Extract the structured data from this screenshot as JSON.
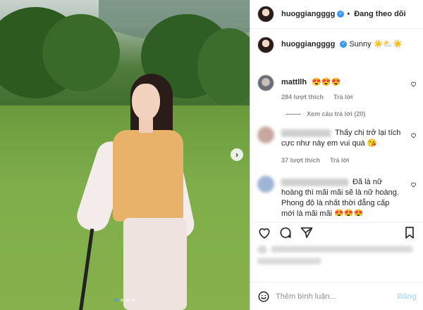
{
  "header": {
    "username": "huoggiangggg",
    "separator": "•",
    "follow_status": "Đang theo dõi"
  },
  "caption": {
    "username": "huoggiangggg",
    "text": "Sunny ☀️⛅☀️"
  },
  "comments": [
    {
      "username": "mattllh",
      "text": "😍😍😍",
      "likes": "284 lượt thích",
      "reply_label": "Trả lời",
      "view_replies": "Xem câu trả lời (20)"
    },
    {
      "username": "",
      "text": "Thấy chị trở lại tích cực như này em vui quá 😘",
      "likes": "37 lượt thích",
      "reply_label": "Trả lời"
    },
    {
      "username": "",
      "text": "Đã là nữ hoàng thì mãi mãi sẽ là nữ hoàng. Phong độ là nhất thời đẳng cấp mới là mãi mãi 😍😍😍"
    }
  ],
  "comment_box": {
    "placeholder": "Thêm bình luận...",
    "post_label": "Đăng"
  },
  "carousel": {
    "next_icon": "›"
  },
  "colors": {
    "accent": "#3897f0",
    "post_disabled": "#b3dbff",
    "meta": "#8e8e8e",
    "text": "#262626"
  }
}
